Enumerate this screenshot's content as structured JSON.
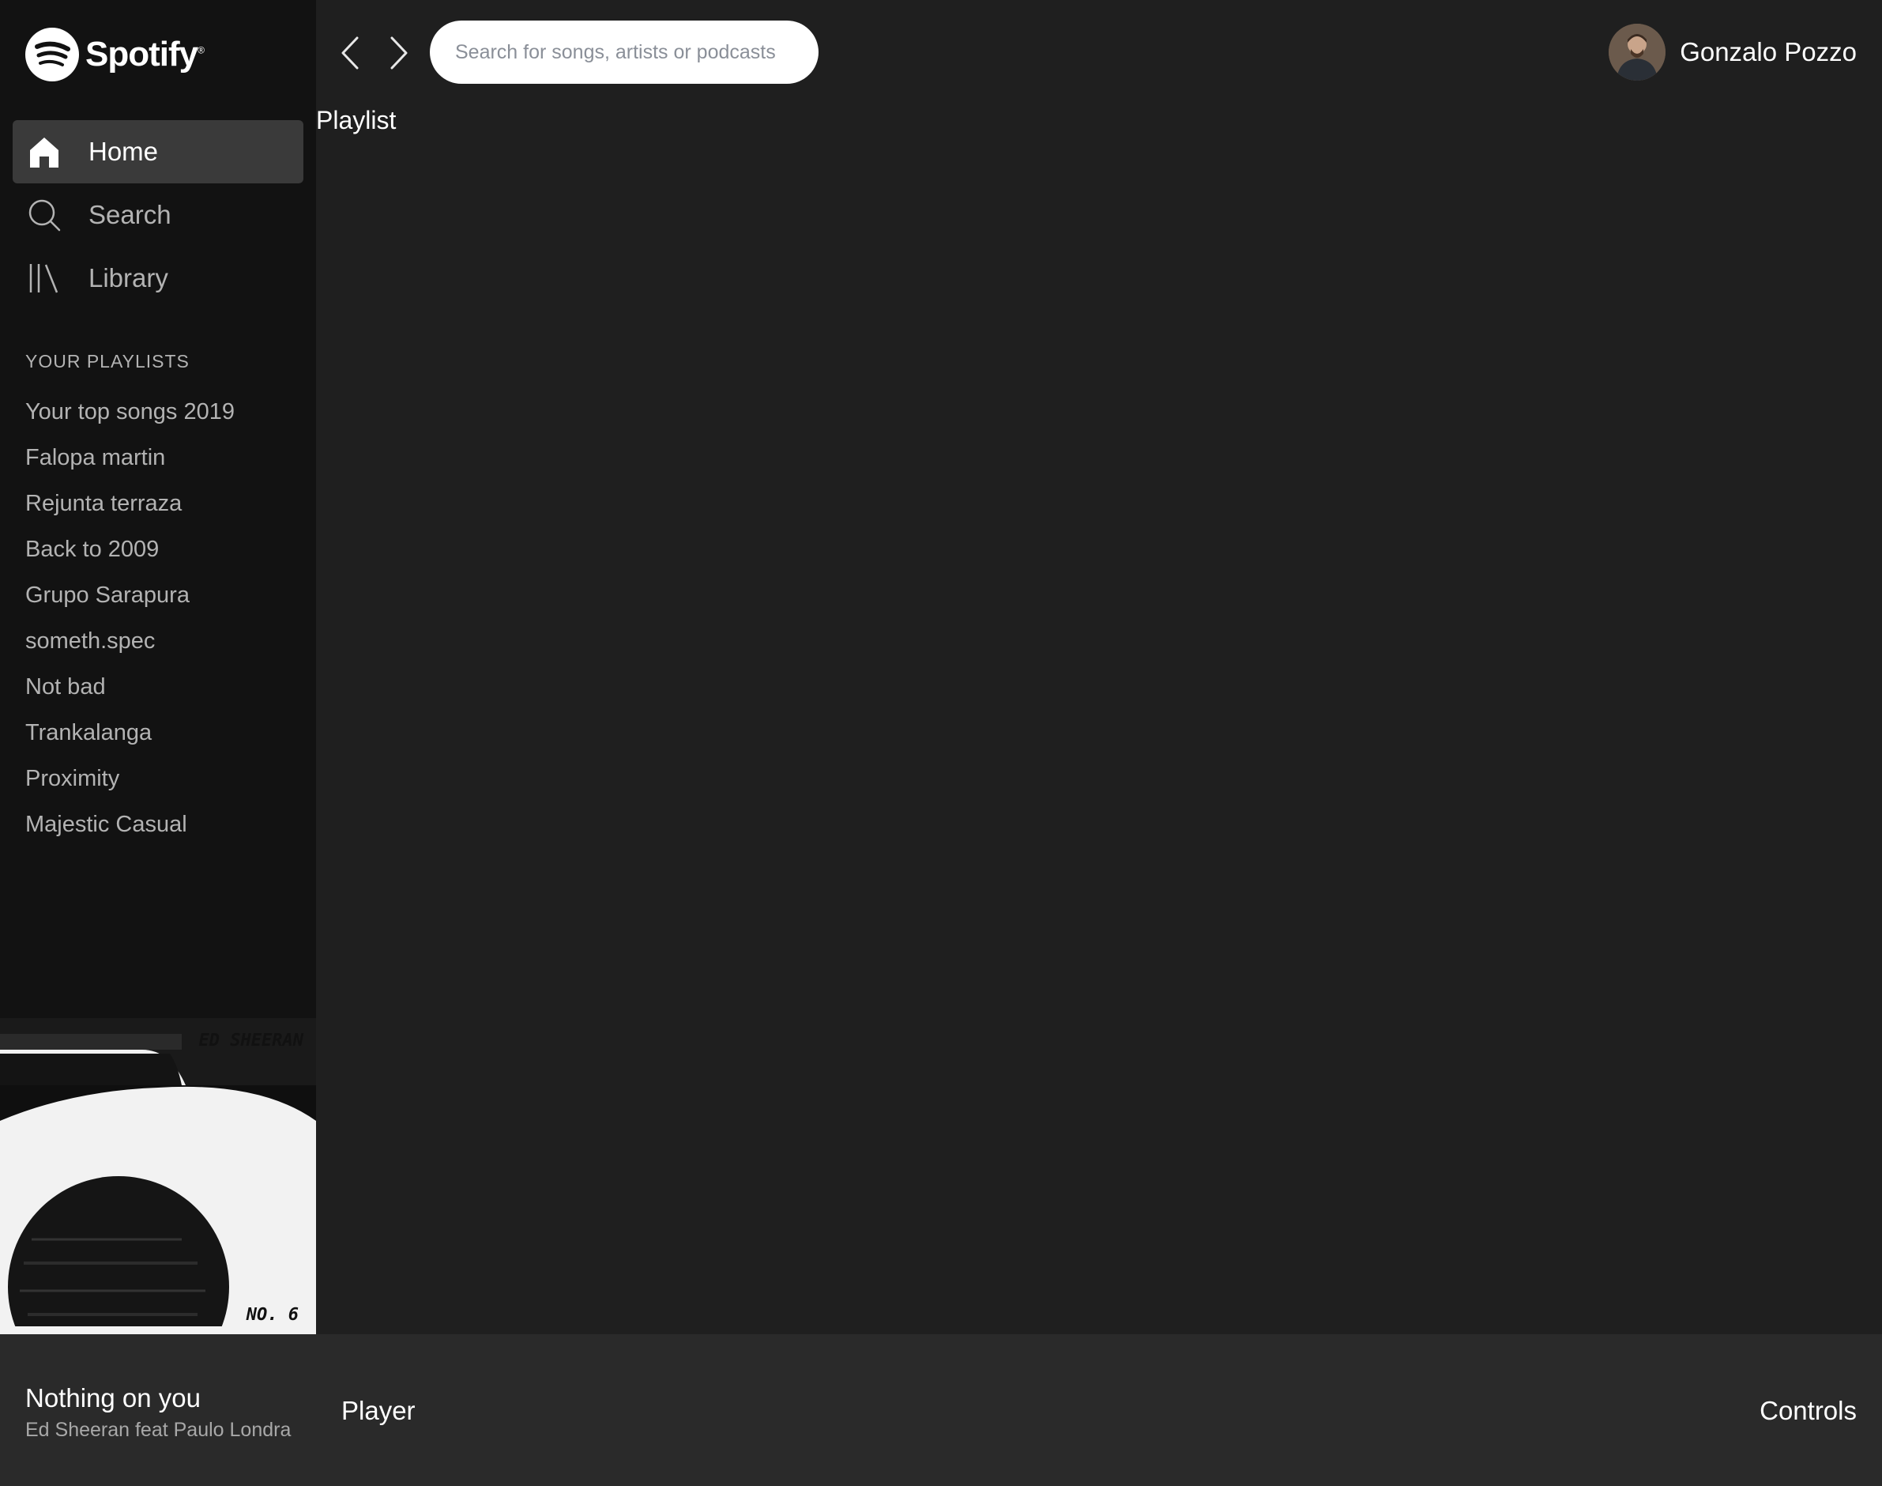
{
  "brand": {
    "name": "Spotify",
    "trademark": "®",
    "logo_icon": "spotify-logo-icon"
  },
  "nav": {
    "items": [
      {
        "label": "Home",
        "icon": "home-icon",
        "active": true
      },
      {
        "label": "Search",
        "icon": "search-icon",
        "active": false
      },
      {
        "label": "Library",
        "icon": "library-icon",
        "active": false
      }
    ]
  },
  "playlists": {
    "title": "YOUR PLAYLISTS",
    "items": [
      "Your top songs 2019",
      "Falopa martin",
      "Rejunta terraza",
      "Back to 2009",
      "Grupo Sarapura",
      "someth.spec",
      "Not bad",
      "Trankalanga",
      "Proximity",
      "Majestic Casual"
    ]
  },
  "album": {
    "artist_text": "ED SHEERAN",
    "album_text": "NO. 6"
  },
  "topbar": {
    "back_icon": "chevron-left-icon",
    "forward_icon": "chevron-right-icon",
    "search_placeholder": "Search for songs, artists or podcasts",
    "search_value": "",
    "user_name": "Gonzalo Pozzo"
  },
  "main": {
    "label": "Playlist"
  },
  "footer": {
    "track_title": "Nothing on you",
    "track_artist": "Ed Sheeran feat Paulo Londra",
    "player_label": "Player",
    "controls_label": "Controls"
  },
  "colors": {
    "sidebar_bg": "#121212",
    "main_bg": "#1f1f1f",
    "footer_bg": "#2a2a2a",
    "active_nav_bg": "#3a3a3a",
    "text_primary": "#ffffff",
    "text_secondary": "#b3b3b3"
  }
}
